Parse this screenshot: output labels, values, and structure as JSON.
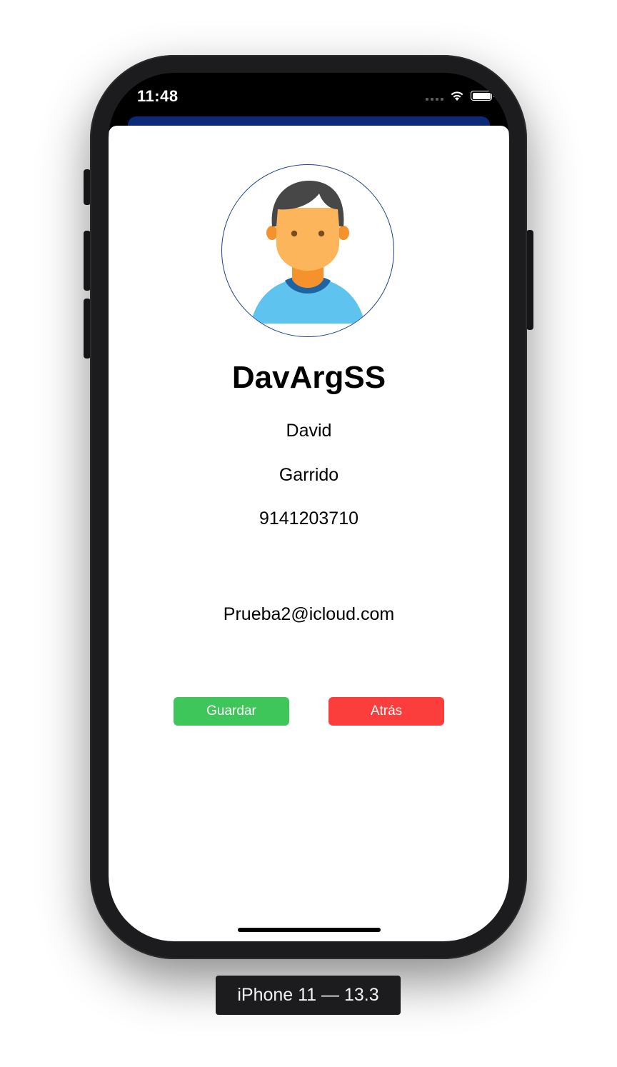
{
  "status_bar": {
    "time": "11:48",
    "icons": [
      "cellular-signal-icon",
      "wifi-icon",
      "battery-icon"
    ]
  },
  "profile": {
    "avatar_icon": "user-avatar-icon",
    "username": "DavArgSS",
    "first_name": "David",
    "last_name": "Garrido",
    "phone": "9141203710",
    "email": "Prueba2@icloud.com"
  },
  "actions": {
    "save_label": "Guardar",
    "back_label": "Atrás",
    "save_color": "#3ec65a",
    "back_color": "#fb3e3c"
  },
  "colors": {
    "nav_background": "#0b2a7a",
    "avatar_ring": "#1f3f8f"
  },
  "simulator": {
    "device_label": "iPhone 11 — 13.3"
  }
}
